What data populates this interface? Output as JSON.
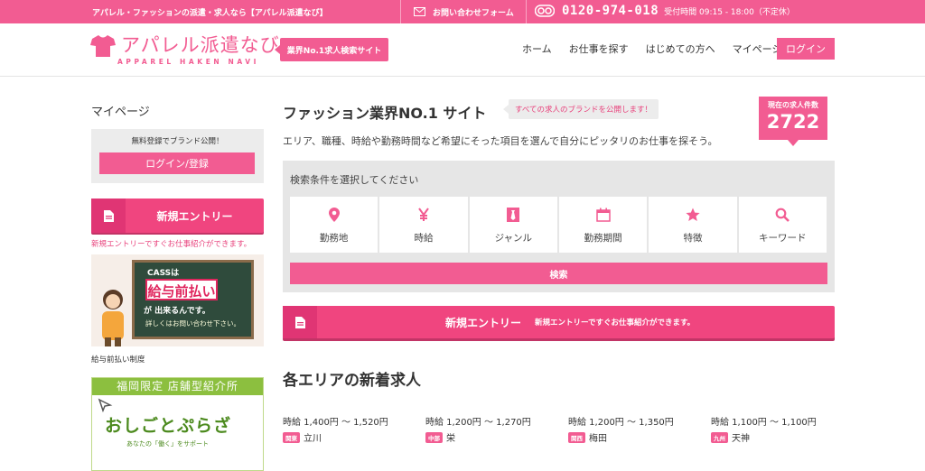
{
  "topbar": {
    "tagline": "アパレル・ファッションの派遣・求人なら【アパレル派遣なび】",
    "contact": "お問い合わせフォーム",
    "phone": "0120-974-018",
    "hours": "受付時間 09:15 - 18:00（不定休）"
  },
  "header": {
    "logo_ja": "アパレル派遣なび",
    "logo_en": "APPAREL HAKEN NAVI",
    "badge": "業界No.1求人検索サイト",
    "nav": [
      "ホーム",
      "お仕事を探す",
      "はじめての方へ",
      "マイページ"
    ],
    "login": "ログイン"
  },
  "sidebar": {
    "mypage": "マイページ",
    "reg_text": "無料登録でブランド公開！",
    "reg_button": "ログイン/登録",
    "entry_label": "新規エントリー",
    "entry_note": "新規エントリーですぐお仕事紹介ができます。",
    "banner1": {
      "line1": "CASSは",
      "line2": "給与前払い",
      "line3": "が 出来るんです。",
      "line4": "詳しくはお問い合わせ下さい。"
    },
    "banner1_caption": "給与前払い制度",
    "banner2": {
      "header": "福岡限定 店舗型紹介所",
      "title": "おしごとぷらざ",
      "sub": "あなたの「働く」をサポート"
    }
  },
  "main": {
    "title": "ファッション業界NO.1 サイト",
    "title_badge": "すべての求人のブランドを公開します！",
    "count_label": "現在の求人件数",
    "count_value": "2722",
    "lead": "エリア、職種、時給や勤務時間など希望にそった項目を選んで自分にピッタリのお仕事を探そう。",
    "search_title": "検索条件を選択してください",
    "categories": [
      {
        "label": "勤務地",
        "icon": "map-pin-icon"
      },
      {
        "label": "時給",
        "icon": "yen-icon"
      },
      {
        "label": "ジャンル",
        "icon": "tie-icon"
      },
      {
        "label": "勤務期間",
        "icon": "calendar-icon"
      },
      {
        "label": "特徴",
        "icon": "star-icon"
      },
      {
        "label": "キーワード",
        "icon": "search-icon"
      }
    ],
    "search_button": "検索",
    "entry_label": "新規エントリー",
    "entry_desc": "新規エントリーですぐお仕事紹介ができます。",
    "area_title": "各エリアの新着求人",
    "jobs": [
      {
        "wage": "時給 1,400円 〜 1,520円",
        "region": "関東",
        "place": "立川"
      },
      {
        "wage": "時給 1,200円 〜 1,270円",
        "region": "中部",
        "place": "栄"
      },
      {
        "wage": "時給 1,200円 〜 1,350円",
        "region": "関西",
        "place": "梅田"
      },
      {
        "wage": "時給 1,100円 〜 1,100円",
        "region": "九州",
        "place": "天神"
      }
    ]
  },
  "colors": {
    "accent": "#f25c92",
    "accent_dark": "#e03574",
    "panel": "#e6e6e6"
  }
}
